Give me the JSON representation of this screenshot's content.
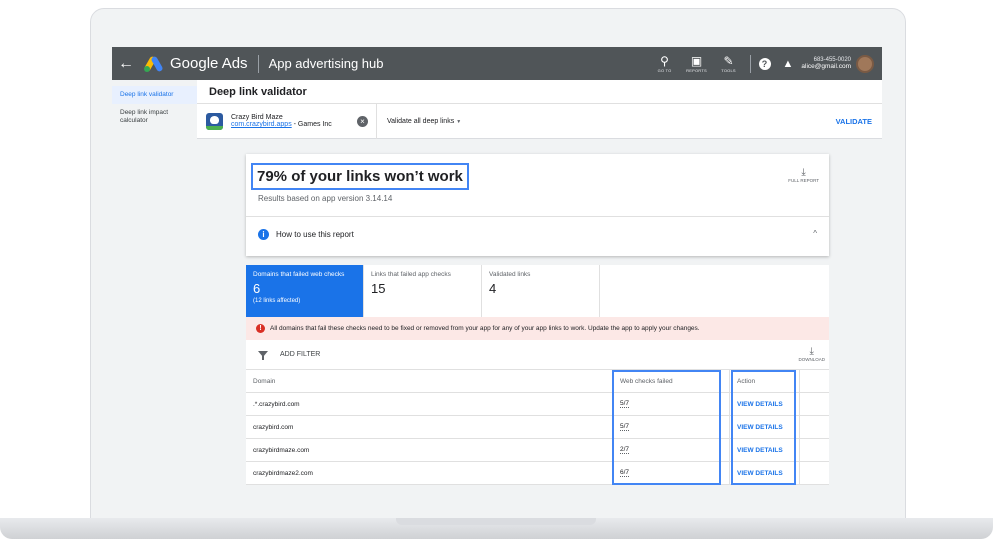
{
  "topbar": {
    "back_label": "←",
    "brand": "Google Ads",
    "title": "App advertising hub",
    "tools": [
      {
        "icon": "search-icon",
        "glyph": "⚲",
        "label": "GO TO"
      },
      {
        "icon": "reports-icon",
        "glyph": "▣",
        "label": "REPORTS"
      },
      {
        "icon": "wrench-icon",
        "glyph": "✎",
        "label": "TOOLS"
      }
    ],
    "help_glyph": "?",
    "bell_glyph": "▲",
    "phone": "683-455-0020",
    "email": "alice@gmail.com"
  },
  "sidebar": {
    "items": [
      {
        "label": "Deep link validator",
        "active": true
      },
      {
        "label": "Deep link impact calculator",
        "active": false
      }
    ]
  },
  "main": {
    "title": "Deep link validator",
    "app": {
      "name": "Crazy Bird Maze",
      "package": "com.crazybird.apps",
      "publisher": " - Games Inc",
      "remove_glyph": "×"
    },
    "validate_select": "Validate all deep links",
    "validate_button": "VALIDATE"
  },
  "report": {
    "headline": "79% of your links won’t work",
    "basis": "Results based on app version 3.14.14",
    "full_report_label": "FULL REPORT",
    "download_glyph": "⤓",
    "howto": "How to use this report",
    "info_glyph": "i",
    "expand_glyph": "^",
    "stats": [
      {
        "label": "Domains that failed web checks",
        "value": "6",
        "sub": "(12 links affected)"
      },
      {
        "label": "Links that failed app checks",
        "value": "15",
        "sub": ""
      },
      {
        "label": "Validated links",
        "value": "4",
        "sub": ""
      }
    ],
    "alert_glyph": "!",
    "alert": "All domains that fail these checks need to be fixed or removed from your app for any of your app links to work. Update the app to apply your changes.",
    "add_filter": "ADD FILTER",
    "download_label": "DOWNLOAD",
    "table": {
      "headers": {
        "domain": "Domain",
        "checks": "Web checks failed",
        "action": "Action"
      },
      "rows": [
        {
          "domain": ".*.crazybird.com",
          "checks": "5/7",
          "action": "VIEW DETAILS"
        },
        {
          "domain": "crazybird.com",
          "checks": "5/7",
          "action": "VIEW DETAILS"
        },
        {
          "domain": "crazybirdmaze.com",
          "checks": "2/7",
          "action": "VIEW DETAILS"
        },
        {
          "domain": "crazybirdmaze2.com",
          "checks": "6/7",
          "action": "VIEW DETAILS"
        }
      ]
    }
  },
  "colors": {
    "accent": "#1a73e8",
    "topbar": "#505558",
    "highlight": "#4285f4",
    "alert_bg": "#fce8e6"
  }
}
